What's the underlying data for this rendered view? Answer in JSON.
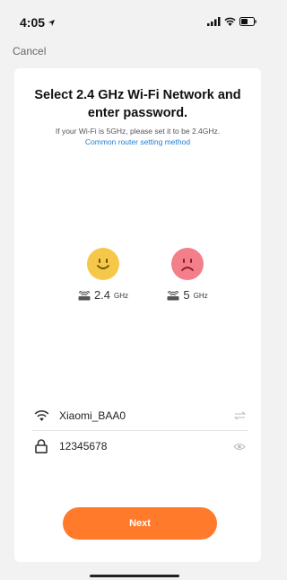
{
  "status_bar": {
    "time": "4:05",
    "icons": [
      "location-arrow-icon",
      "cellular-signal-icon",
      "wifi-icon",
      "battery-icon"
    ]
  },
  "nav": {
    "cancel_label": "Cancel"
  },
  "card": {
    "title_line1": "Select 2.4 GHz Wi-Fi Network and",
    "title_line2": "enter password.",
    "hint": "If your Wi-Fi is 5GHz, please set it to be 2.4GHz.",
    "router_link": "Common router setting method"
  },
  "bands": [
    {
      "main": "2.4",
      "unit": "GHz",
      "face": "smiley-face-icon",
      "face_color": "#f6c84a"
    },
    {
      "main": "5",
      "unit": "GHz",
      "face": "sad-face-icon",
      "face_color": "#f27f8a"
    }
  ],
  "form": {
    "ssid_value": "Xiaomi_BAA0",
    "password_value": "12345678"
  },
  "actions": {
    "next_label": "Next"
  },
  "colors": {
    "accent": "#ff7a2a",
    "link": "#1e7fd6",
    "background": "#f2f2f2"
  }
}
